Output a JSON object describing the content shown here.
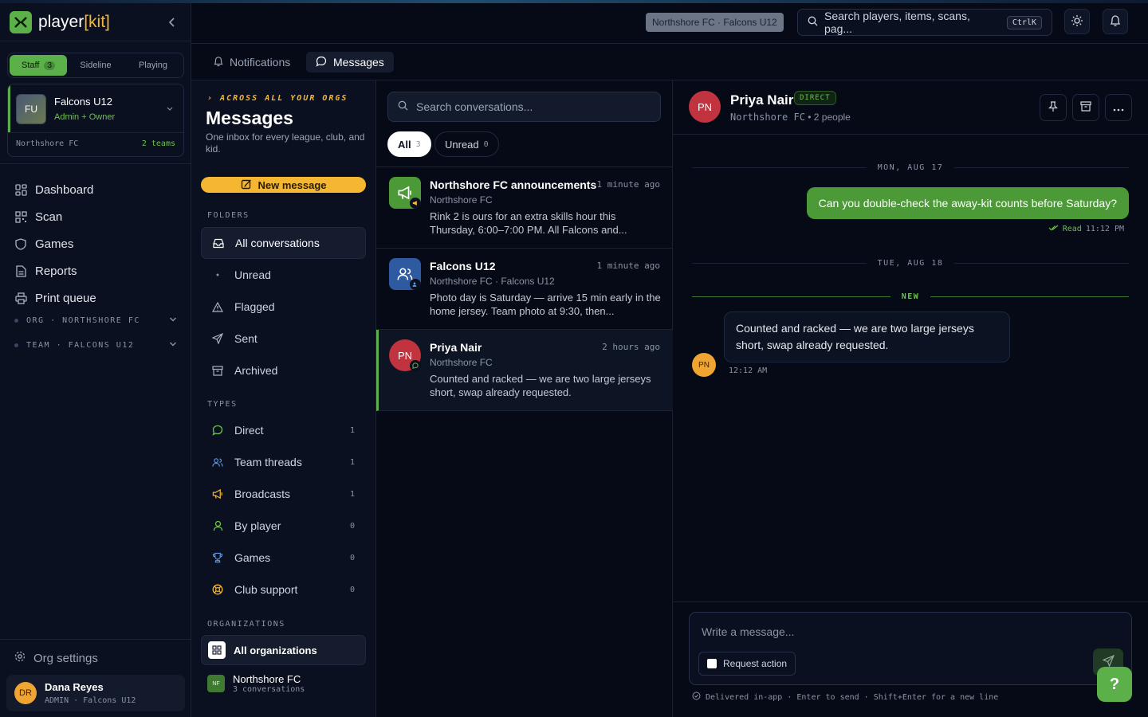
{
  "app": {
    "logo_prefix": "player",
    "logo_bracket_open": "[",
    "logo_suffix": "kit",
    "logo_bracket_close": "]"
  },
  "modes": [
    {
      "label": "Staff",
      "count": "3"
    },
    {
      "label": "Sideline"
    },
    {
      "label": "Playing"
    }
  ],
  "team_card": {
    "initials": "FU",
    "name": "Falcons U12",
    "role": "Admin + Owner",
    "org": "Northshore FC",
    "teams": "2 teams"
  },
  "nav": {
    "items": [
      "Dashboard",
      "Scan",
      "Games",
      "Reports",
      "Print queue"
    ],
    "groups": [
      "ORG · NORTHSHORE FC",
      "TEAM · FALCONS U12"
    ],
    "org_settings": "Org settings"
  },
  "user": {
    "initials": "DR",
    "name": "Dana Reyes",
    "role": "ADMIN · Falcons U12"
  },
  "topbar": {
    "context": "Northshore FC · Falcons U12",
    "search_placeholder": "Search players, items, scans, pag...",
    "shortcut": "CtrlK"
  },
  "subtabs": [
    "Notifications",
    "Messages"
  ],
  "folders_panel": {
    "eyebrow": "ACROSS ALL YOUR ORGS",
    "title": "Messages",
    "subtitle": "One inbox for every league, club, and kid.",
    "new_message": "New message",
    "folders_label": "FOLDERS",
    "folders": [
      "All conversations",
      "Unread",
      "Flagged",
      "Sent",
      "Archived"
    ],
    "types_label": "TYPES",
    "types": [
      {
        "label": "Direct",
        "count": "1"
      },
      {
        "label": "Team threads",
        "count": "1"
      },
      {
        "label": "Broadcasts",
        "count": "1"
      },
      {
        "label": "By player",
        "count": "0"
      },
      {
        "label": "Games",
        "count": "0"
      },
      {
        "label": "Club support",
        "count": "0"
      }
    ],
    "orgs_label": "ORGANIZATIONS",
    "all_orgs": "All organizations",
    "org": {
      "initials": "NF",
      "name": "Northshore FC",
      "sub": "3 conversations"
    }
  },
  "conversation_list": {
    "search_placeholder": "Search conversations...",
    "filters": [
      {
        "label": "All",
        "count": "3"
      },
      {
        "label": "Unread",
        "count": "0"
      }
    ],
    "items": [
      {
        "title": "Northshore FC announcements",
        "time": "1 minute ago",
        "org": "Northshore FC",
        "preview": "Rink 2 is ours for an extra skills hour this Thursday, 6:00–7:00 PM. All Falcons and..."
      },
      {
        "title": "Falcons U12",
        "time": "1 minute ago",
        "org": "Northshore FC · Falcons U12",
        "preview": "Photo day is Saturday — arrive 15 min early in the home jersey. Team photo at 9:30, then..."
      },
      {
        "initials": "PN",
        "title": "Priya Nair",
        "time": "2 hours ago",
        "org": "Northshore FC",
        "preview": "Counted and racked — we are two large jerseys short, swap already requested."
      }
    ]
  },
  "thread": {
    "initials": "PN",
    "name": "Priya Nair",
    "tag": "DIRECT",
    "sub_org": "Northshore FC",
    "sub_people": "2 people",
    "day1": "MON, AUG 17",
    "outgoing": "Can you double-check the away-kit counts before Saturday?",
    "read_label": "Read",
    "read_time": "11:12 PM",
    "day2": "TUE, AUG 18",
    "new_label": "NEW",
    "incoming": "Counted and racked — we are two large jerseys short, swap already requested.",
    "incoming_initials": "PN",
    "incoming_time": "12:12 AM",
    "composer_placeholder": "Write a message...",
    "request_action": "Request action",
    "footer": "Delivered in-app · Enter to send · Shift+Enter for a new line"
  },
  "help_label": "?"
}
